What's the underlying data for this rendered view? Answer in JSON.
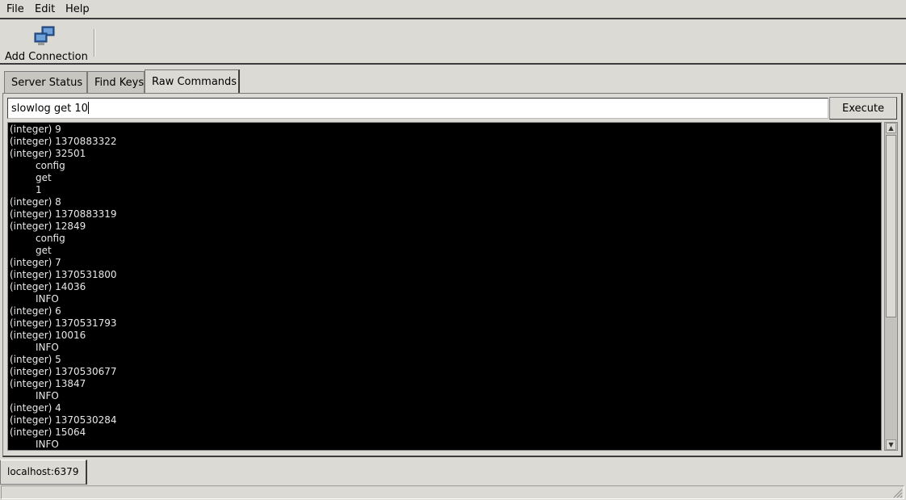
{
  "menu": {
    "file": "File",
    "edit": "Edit",
    "help": "Help"
  },
  "toolbar": {
    "add_connection": "Add Connection"
  },
  "tabs": [
    "Server Status",
    "Find Keys",
    "Raw Commands"
  ],
  "command": {
    "value": "slowlog get 10",
    "execute": "Execute"
  },
  "output": [
    {
      "t": "(integer) 9",
      "i": false
    },
    {
      "t": "(integer) 1370883322",
      "i": false
    },
    {
      "t": "(integer) 32501",
      "i": false
    },
    {
      "t": "config",
      "i": true
    },
    {
      "t": "get",
      "i": true
    },
    {
      "t": "1",
      "i": true
    },
    {
      "t": "(integer) 8",
      "i": false
    },
    {
      "t": "(integer) 1370883319",
      "i": false
    },
    {
      "t": "(integer) 12849",
      "i": false
    },
    {
      "t": "config",
      "i": true
    },
    {
      "t": "get",
      "i": true
    },
    {
      "t": "(integer) 7",
      "i": false
    },
    {
      "t": "(integer) 1370531800",
      "i": false
    },
    {
      "t": "(integer) 14036",
      "i": false
    },
    {
      "t": "INFO",
      "i": true
    },
    {
      "t": "(integer) 6",
      "i": false
    },
    {
      "t": "(integer) 1370531793",
      "i": false
    },
    {
      "t": "(integer) 10016",
      "i": false
    },
    {
      "t": "INFO",
      "i": true
    },
    {
      "t": "(integer) 5",
      "i": false
    },
    {
      "t": "(integer) 1370530677",
      "i": false
    },
    {
      "t": "(integer) 13847",
      "i": false
    },
    {
      "t": "INFO",
      "i": true
    },
    {
      "t": "(integer) 4",
      "i": false
    },
    {
      "t": "(integer) 1370530284",
      "i": false
    },
    {
      "t": "(integer) 15064",
      "i": false
    },
    {
      "t": "INFO",
      "i": true
    }
  ],
  "connection_tab": "localhost:6379",
  "colors": {
    "output_bg": "#000000",
    "output_fg": "#e8e8e8",
    "window_bg": "#dcdad5"
  }
}
